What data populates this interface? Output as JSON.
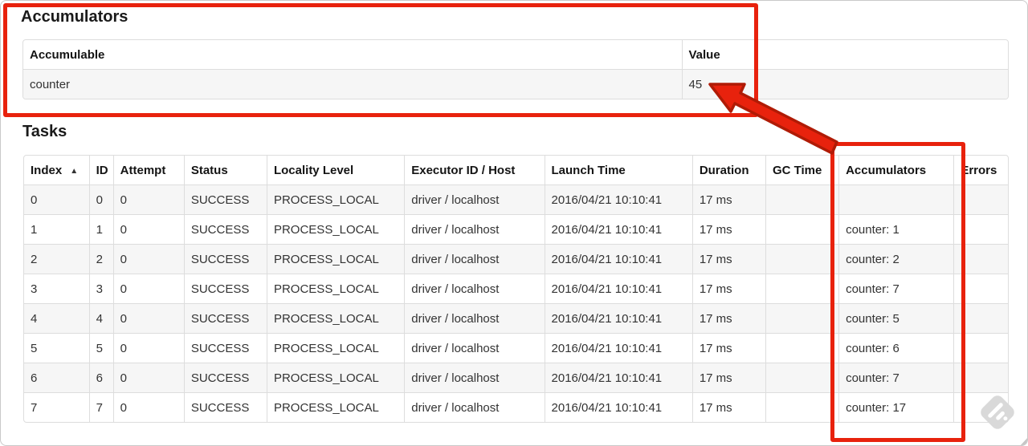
{
  "accumulators_section": {
    "title": "Accumulators",
    "table": {
      "headers": [
        "Accumulable",
        "Value"
      ],
      "rows": [
        {
          "accumulable": "counter",
          "value": "45"
        }
      ]
    }
  },
  "tasks_section": {
    "title": "Tasks",
    "sort_indicator": "▲",
    "table": {
      "headers": [
        "Index",
        "ID",
        "Attempt",
        "Status",
        "Locality Level",
        "Executor ID / Host",
        "Launch Time",
        "Duration",
        "GC Time",
        "Accumulators",
        "Errors"
      ],
      "rows": [
        {
          "index": "0",
          "id": "0",
          "attempt": "0",
          "status": "SUCCESS",
          "locality_level": "PROCESS_LOCAL",
          "executor_id_host": "driver / localhost",
          "launch_time": "2016/04/21 10:10:41",
          "duration": "17 ms",
          "gc_time": "",
          "accumulators": "",
          "errors": ""
        },
        {
          "index": "1",
          "id": "1",
          "attempt": "0",
          "status": "SUCCESS",
          "locality_level": "PROCESS_LOCAL",
          "executor_id_host": "driver / localhost",
          "launch_time": "2016/04/21 10:10:41",
          "duration": "17 ms",
          "gc_time": "",
          "accumulators": "counter: 1",
          "errors": ""
        },
        {
          "index": "2",
          "id": "2",
          "attempt": "0",
          "status": "SUCCESS",
          "locality_level": "PROCESS_LOCAL",
          "executor_id_host": "driver / localhost",
          "launch_time": "2016/04/21 10:10:41",
          "duration": "17 ms",
          "gc_time": "",
          "accumulators": "counter: 2",
          "errors": ""
        },
        {
          "index": "3",
          "id": "3",
          "attempt": "0",
          "status": "SUCCESS",
          "locality_level": "PROCESS_LOCAL",
          "executor_id_host": "driver / localhost",
          "launch_time": "2016/04/21 10:10:41",
          "duration": "17 ms",
          "gc_time": "",
          "accumulators": "counter: 7",
          "errors": ""
        },
        {
          "index": "4",
          "id": "4",
          "attempt": "0",
          "status": "SUCCESS",
          "locality_level": "PROCESS_LOCAL",
          "executor_id_host": "driver / localhost",
          "launch_time": "2016/04/21 10:10:41",
          "duration": "17 ms",
          "gc_time": "",
          "accumulators": "counter: 5",
          "errors": ""
        },
        {
          "index": "5",
          "id": "5",
          "attempt": "0",
          "status": "SUCCESS",
          "locality_level": "PROCESS_LOCAL",
          "executor_id_host": "driver / localhost",
          "launch_time": "2016/04/21 10:10:41",
          "duration": "17 ms",
          "gc_time": "",
          "accumulators": "counter: 6",
          "errors": ""
        },
        {
          "index": "6",
          "id": "6",
          "attempt": "0",
          "status": "SUCCESS",
          "locality_level": "PROCESS_LOCAL",
          "executor_id_host": "driver / localhost",
          "launch_time": "2016/04/21 10:10:41",
          "duration": "17 ms",
          "gc_time": "",
          "accumulators": "counter: 7",
          "errors": ""
        },
        {
          "index": "7",
          "id": "7",
          "attempt": "0",
          "status": "SUCCESS",
          "locality_level": "PROCESS_LOCAL",
          "executor_id_host": "driver / localhost",
          "launch_time": "2016/04/21 10:10:41",
          "duration": "17 ms",
          "gc_time": "",
          "accumulators": "counter: 17",
          "errors": ""
        }
      ]
    }
  },
  "annotations": {
    "highlight_color": "#e8220d",
    "highlight_outline_color": "#b01b06"
  },
  "watermark_color": "#d9d9d9"
}
